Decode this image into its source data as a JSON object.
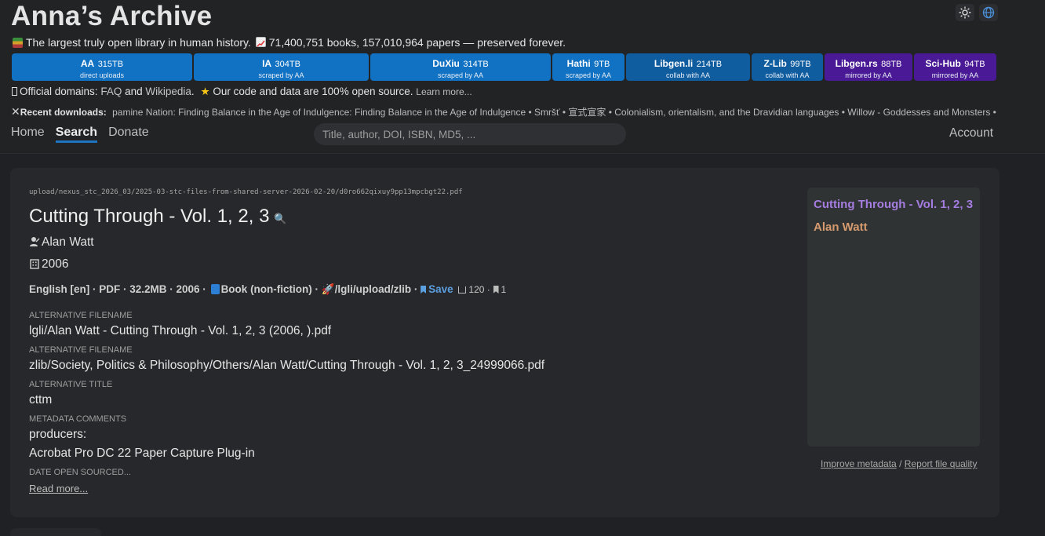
{
  "site_title": "Anna’s Archive",
  "tagline": {
    "part1": "The largest truly open library in human history.",
    "part2": "71,400,751 books, 157,010,964 papers — preserved forever."
  },
  "sources": [
    {
      "name": "AA",
      "size": "315TB",
      "sub": "direct uploads",
      "color": "#1171c2"
    },
    {
      "name": "IA",
      "size": "304TB",
      "sub": "scraped by AA",
      "color": "#1171c2"
    },
    {
      "name": "DuXiu",
      "size": "314TB",
      "sub": "scraped by AA",
      "color": "#1171c2"
    },
    {
      "name": "Hathi",
      "size": "9TB",
      "sub": "scraped by AA",
      "color": "#1171c2"
    },
    {
      "name": "Libgen.li",
      "size": "214TB",
      "sub": "collab with AA",
      "color": "#0f5c9f"
    },
    {
      "name": "Z-Lib",
      "size": "99TB",
      "sub": "collab with AA",
      "color": "#0f5c9f"
    },
    {
      "name": "Libgen.rs",
      "size": "88TB",
      "sub": "mirrored by AA",
      "color": "#4a1a96"
    },
    {
      "name": "Sci-Hub",
      "size": "94TB",
      "sub": "mirrored by AA",
      "color": "#4a1a96"
    }
  ],
  "domains": {
    "prefix": "Official domains:",
    "faq": "FAQ",
    "and": "and",
    "wikipedia": "Wikipedia",
    "dot": ".",
    "open_source": "Our code and data are 100% open source.",
    "learn_more": "Learn more..."
  },
  "recent": {
    "label": "Recent downloads:",
    "items": "pamine Nation: Finding Balance in the Age of Indulgence: Finding Balance in the Age of Indulgence • Smršť • 宣式宣家 • Colonialism, orientalism, and the Dravidian languages • Willow - Goddesses and Monsters • C"
  },
  "nav": {
    "home": "Home",
    "search": "Search",
    "donate": "Donate",
    "account": "Account",
    "search_placeholder": "Title, author, DOI, ISBN, MD5, ..."
  },
  "record": {
    "path": "upload/nexus_stc_2026_03/2025-03-stc-files-from-shared-server-2026-02-20/d0ro662qixuy9pp13mpcbgt22.pdf",
    "title": "Cutting Through - Vol. 1, 2, 3",
    "author": "Alan Watt",
    "year": "2006",
    "meta_left": "English [en] · PDF · 32.2MB · 2006 ·",
    "meta_type": "Book (non-fiction) ·",
    "meta_source": "/lgli/upload/zlib ·",
    "save": "Save",
    "downloads": "120 ·",
    "lists": "1",
    "fields": [
      {
        "label": "Alternative filename",
        "value": "lgli/Alan Watt - Cutting Through - Vol. 1, 2, 3 (2006, ).pdf"
      },
      {
        "label": "Alternative filename",
        "value": "zlib/Society, Politics & Philosophy/Others/Alan Watt/Cutting Through - Vol. 1, 2, 3_24999066.pdf"
      },
      {
        "label": "Alternative title",
        "value": "cttm"
      },
      {
        "label": "Metadata comments",
        "value": "producers:"
      }
    ],
    "comment_line2": "Acrobat Pro DC 22 Paper Capture Plug-in",
    "date_label": "Date open sourced...",
    "read_more": "Read more...",
    "cover_title": "Cutting Through - Vol. 1, 2, 3",
    "cover_author": "Alan Watt",
    "improve": "Improve metadata",
    "slash": "/",
    "report": "Report file quality"
  }
}
